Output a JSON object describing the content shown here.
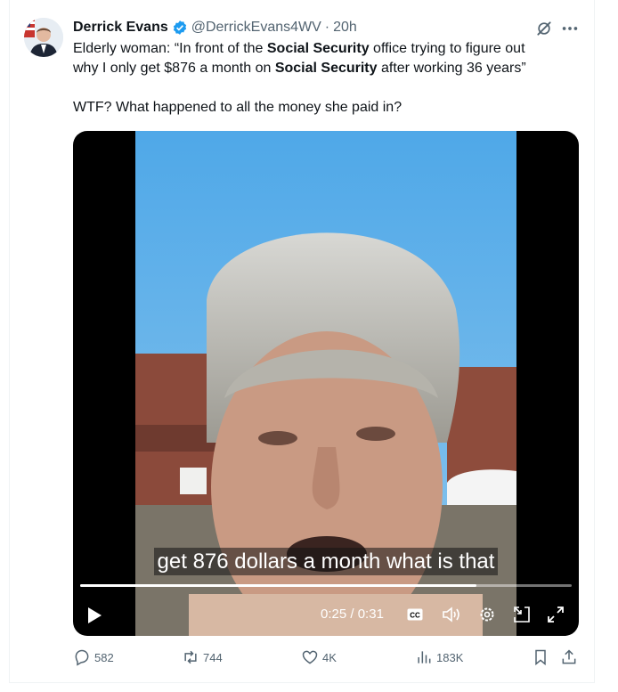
{
  "post": {
    "author_name": "Derrick Evans",
    "handle": "@DerrickEvans4WV",
    "separator": "·",
    "time": "20h",
    "text_line1_a": "Elderly woman: “In front of the ",
    "text_line1_b": "Social Security",
    "text_line1_c": " office trying to figure out",
    "text_line2_a": "why I only get $876 a month on ",
    "text_line2_b": "Social Security",
    "text_line2_c": " after working 36 years”",
    "text_line3": "WTF? What happened to all the money she paid in?"
  },
  "video": {
    "subtitle": "get 876 dollars a month what is that",
    "current_time": "0:25",
    "time_separator": " / ",
    "duration": "0:31",
    "progress_fraction": 0.806,
    "cc_label": "CC"
  },
  "actions": {
    "replies": "582",
    "reposts": "744",
    "likes": "4K",
    "views": "183K"
  },
  "colors": {
    "verified": "#1d9bf0",
    "muted": "#536471",
    "text": "#0f1419",
    "sky": "#5aaee6"
  },
  "icons": [
    "verified-badge-icon",
    "grok-icon",
    "more-icon",
    "play-icon",
    "cc-icon",
    "volume-icon",
    "settings-icon",
    "pip-icon",
    "fullscreen-icon",
    "reply-icon",
    "repost-icon",
    "like-icon",
    "views-icon",
    "bookmark-icon",
    "share-icon"
  ]
}
